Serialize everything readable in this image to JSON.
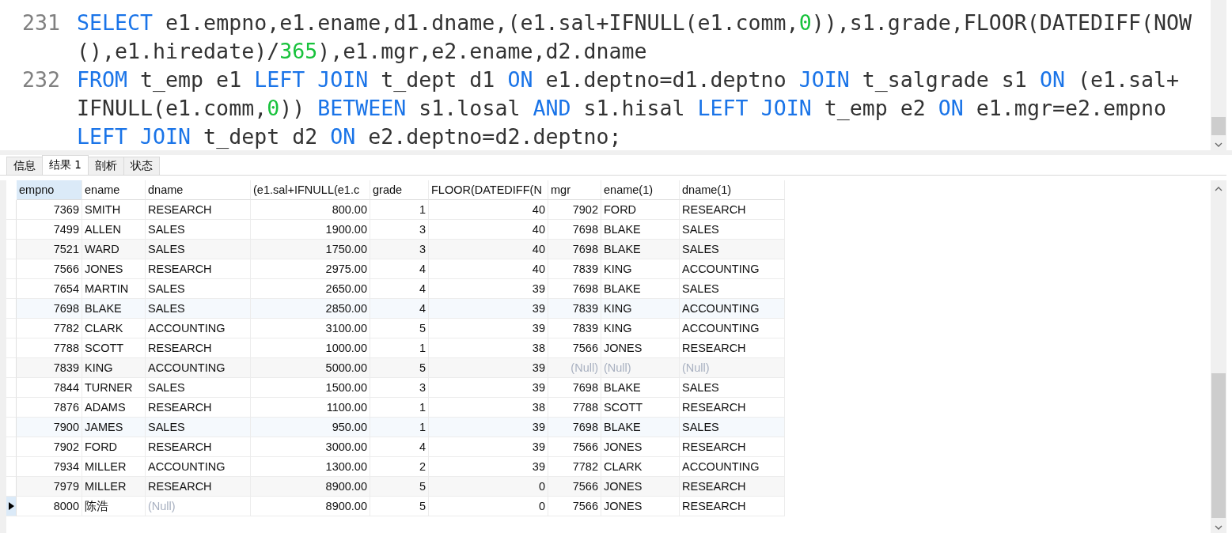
{
  "editor": {
    "lines": [
      {
        "number": "231",
        "rows": [
          {
            "tokens": [
              {
                "t": "SELECT",
                "kind": "keyword"
              },
              {
                "t": " e1.empno,e1.ename,d1.dname,(e1.sal+IFNULL(e1.comm,",
                "kind": "plain"
              },
              {
                "t": "0",
                "kind": "number"
              },
              {
                "t": ")),s1.grade,FLOOR(DATEDIFF(NOW",
                "kind": "plain"
              }
            ]
          },
          {
            "tokens": [
              {
                "t": "(),e1.hiredate)/",
                "kind": "plain"
              },
              {
                "t": "365",
                "kind": "number"
              },
              {
                "t": "),e1.mgr,e2.ename,d2.dname",
                "kind": "plain"
              }
            ]
          }
        ]
      },
      {
        "number": "232",
        "rows": [
          {
            "tokens": [
              {
                "t": "FROM",
                "kind": "keyword"
              },
              {
                "t": " t_emp e1 ",
                "kind": "plain"
              },
              {
                "t": "LEFT JOIN",
                "kind": "keyword"
              },
              {
                "t": " t_dept d1 ",
                "kind": "plain"
              },
              {
                "t": "ON",
                "kind": "keyword"
              },
              {
                "t": " e1.deptno=d1.deptno ",
                "kind": "plain"
              },
              {
                "t": "JOIN",
                "kind": "keyword"
              },
              {
                "t": " t_salgrade s1 ",
                "kind": "plain"
              },
              {
                "t": "ON",
                "kind": "keyword"
              },
              {
                "t": " (e1.sal+",
                "kind": "plain"
              }
            ]
          },
          {
            "tokens": [
              {
                "t": "IFNULL(e1.comm,",
                "kind": "plain"
              },
              {
                "t": "0",
                "kind": "number"
              },
              {
                "t": ")) ",
                "kind": "plain"
              },
              {
                "t": "BETWEEN",
                "kind": "keyword"
              },
              {
                "t": " s1.losal ",
                "kind": "plain"
              },
              {
                "t": "AND",
                "kind": "keyword"
              },
              {
                "t": " s1.hisal ",
                "kind": "plain"
              },
              {
                "t": "LEFT JOIN",
                "kind": "keyword"
              },
              {
                "t": " t_emp e2 ",
                "kind": "plain"
              },
              {
                "t": "ON",
                "kind": "keyword"
              },
              {
                "t": " e1.mgr=e2.empno",
                "kind": "plain"
              }
            ]
          },
          {
            "tokens": [
              {
                "t": "LEFT JOIN",
                "kind": "keyword"
              },
              {
                "t": " t_dept d2 ",
                "kind": "plain"
              },
              {
                "t": "ON",
                "kind": "keyword"
              },
              {
                "t": " e2.deptno=d2.deptno;",
                "kind": "plain"
              }
            ]
          }
        ]
      }
    ]
  },
  "tabs": [
    {
      "label": "信息",
      "selected": false
    },
    {
      "label": "结果 1",
      "selected": true
    },
    {
      "label": "剖析",
      "selected": false
    },
    {
      "label": "状态",
      "selected": false
    }
  ],
  "table": {
    "columns": [
      {
        "label": "empno",
        "kind": "number",
        "selected": true
      },
      {
        "label": "ename",
        "kind": "text",
        "selected": false
      },
      {
        "label": "dname",
        "kind": "text",
        "selected": false
      },
      {
        "label": "(e1.sal+IFNULL(e1.c",
        "kind": "number",
        "selected": false
      },
      {
        "label": "grade",
        "kind": "number",
        "selected": false
      },
      {
        "label": "FLOOR(DATEDIFF(N",
        "kind": "number",
        "selected": false
      },
      {
        "label": "mgr",
        "kind": "number",
        "selected": false
      },
      {
        "label": "ename(1)",
        "kind": "text",
        "selected": false
      },
      {
        "label": "dname(1)",
        "kind": "text",
        "selected": false
      }
    ],
    "rows": [
      {
        "selected": false,
        "cells": [
          "7369",
          "SMITH",
          "RESEARCH",
          "800.00",
          "1",
          "40",
          "7902",
          "FORD",
          "RESEARCH"
        ]
      },
      {
        "selected": false,
        "cells": [
          "7499",
          "ALLEN",
          "SALES",
          "1900.00",
          "3",
          "40",
          "7698",
          "BLAKE",
          "SALES"
        ]
      },
      {
        "selected": false,
        "cells": [
          "7521",
          "WARD",
          "SALES",
          "1750.00",
          "3",
          "40",
          "7698",
          "BLAKE",
          "SALES"
        ]
      },
      {
        "selected": false,
        "cells": [
          "7566",
          "JONES",
          "RESEARCH",
          "2975.00",
          "4",
          "40",
          "7839",
          "KING",
          "ACCOUNTING"
        ]
      },
      {
        "selected": false,
        "cells": [
          "7654",
          "MARTIN",
          "SALES",
          "2650.00",
          "4",
          "39",
          "7698",
          "BLAKE",
          "SALES"
        ]
      },
      {
        "selected": false,
        "cells": [
          "7698",
          "BLAKE",
          "SALES",
          "2850.00",
          "4",
          "39",
          "7839",
          "KING",
          "ACCOUNTING"
        ]
      },
      {
        "selected": false,
        "cells": [
          "7782",
          "CLARK",
          "ACCOUNTING",
          "3100.00",
          "5",
          "39",
          "7839",
          "KING",
          "ACCOUNTING"
        ]
      },
      {
        "selected": false,
        "cells": [
          "7788",
          "SCOTT",
          "RESEARCH",
          "1000.00",
          "1",
          "38",
          "7566",
          "JONES",
          "RESEARCH"
        ]
      },
      {
        "selected": false,
        "cells": [
          "7839",
          "KING",
          "ACCOUNTING",
          "5000.00",
          "5",
          "39",
          {
            "text": "(Null)",
            "null": true
          },
          {
            "text": "(Null)",
            "null": true
          },
          {
            "text": "(Null)",
            "null": true
          }
        ]
      },
      {
        "selected": false,
        "cells": [
          "7844",
          "TURNER",
          "SALES",
          "1500.00",
          "3",
          "39",
          "7698",
          "BLAKE",
          "SALES"
        ]
      },
      {
        "selected": false,
        "cells": [
          "7876",
          "ADAMS",
          "RESEARCH",
          "1100.00",
          "1",
          "38",
          "7788",
          "SCOTT",
          "RESEARCH"
        ]
      },
      {
        "selected": false,
        "cells": [
          "7900",
          "JAMES",
          "SALES",
          "950.00",
          "1",
          "39",
          "7698",
          "BLAKE",
          "SALES"
        ]
      },
      {
        "selected": false,
        "cells": [
          "7902",
          "FORD",
          "RESEARCH",
          "3000.00",
          "4",
          "39",
          "7566",
          "JONES",
          "RESEARCH"
        ]
      },
      {
        "selected": false,
        "cells": [
          "7934",
          "MILLER",
          "ACCOUNTING",
          "1300.00",
          "2",
          "39",
          "7782",
          "CLARK",
          "ACCOUNTING"
        ]
      },
      {
        "selected": false,
        "cells": [
          "7979",
          "MILLER",
          "RESEARCH",
          "8900.00",
          "5",
          "0",
          "7566",
          "JONES",
          "RESEARCH"
        ]
      },
      {
        "selected": true,
        "cells": [
          "8000",
          "陈浩",
          {
            "text": "(Null)",
            "null": true
          },
          "8900.00",
          "5",
          "0",
          "7566",
          "JONES",
          "RESEARCH"
        ]
      }
    ]
  }
}
